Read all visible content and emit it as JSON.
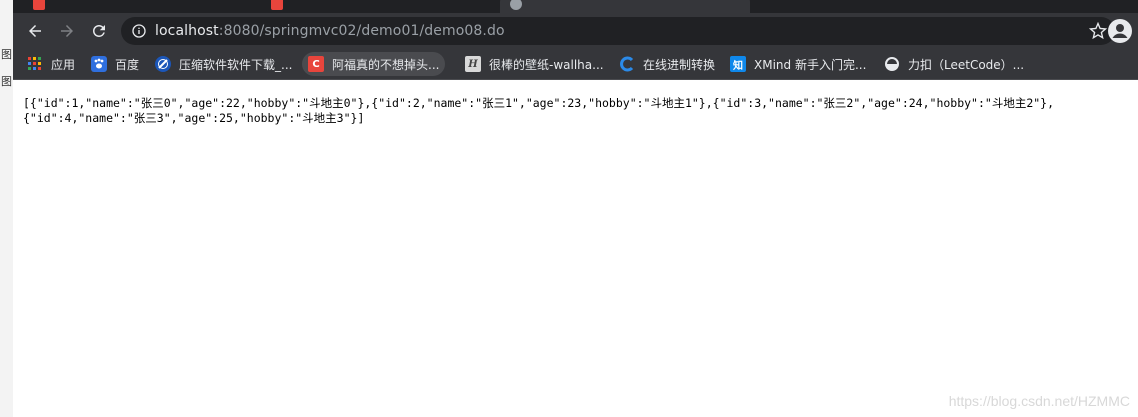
{
  "side_window": {
    "glyphs": [
      "图",
      "图"
    ]
  },
  "tabs": [
    {
      "label": ""
    },
    {
      "label": ""
    },
    {
      "label": ""
    }
  ],
  "toolbar": {
    "url_host": "localhost",
    "url_path": ":8080/springmvc02/demo01/demo08.do"
  },
  "bookmarks": [
    {
      "label": "应用",
      "icon": "apps-grid-icon"
    },
    {
      "label": "百度",
      "icon": "baidu-paw-icon"
    },
    {
      "label": "压缩软件软件下载_...",
      "icon": "compress-icon"
    },
    {
      "label": "阿福真的不想掉头...",
      "icon": "csdn-icon",
      "icon_text": "C"
    },
    {
      "label": "很棒的壁纸-wallha...",
      "icon": "wallhaven-icon",
      "icon_text": "H"
    },
    {
      "label": "在线进制转换",
      "icon": "converter-icon"
    },
    {
      "label": "XMind 新手入门完...",
      "icon": "zhihu-icon",
      "icon_text": "知"
    },
    {
      "label": "力扣（LeetCode）...",
      "icon": "leetcode-icon"
    }
  ],
  "content": {
    "json_text": "[{\"id\":1,\"name\":\"张三0\",\"age\":22,\"hobby\":\"斗地主0\"},{\"id\":2,\"name\":\"张三1\",\"age\":23,\"hobby\":\"斗地主1\"},{\"id\":3,\"name\":\"张三2\",\"age\":24,\"hobby\":\"斗地主2\"},\n{\"id\":4,\"name\":\"张三3\",\"age\":25,\"hobby\":\"斗地主3\"}]"
  },
  "watermark": "https://blog.csdn.net/HZMMC",
  "colors": {
    "tabstrip": "#202124",
    "toolbar": "#35363a",
    "omnibox": "#202124",
    "csdn_red": "#e8453c",
    "zhihu_blue": "#0f88eb"
  }
}
